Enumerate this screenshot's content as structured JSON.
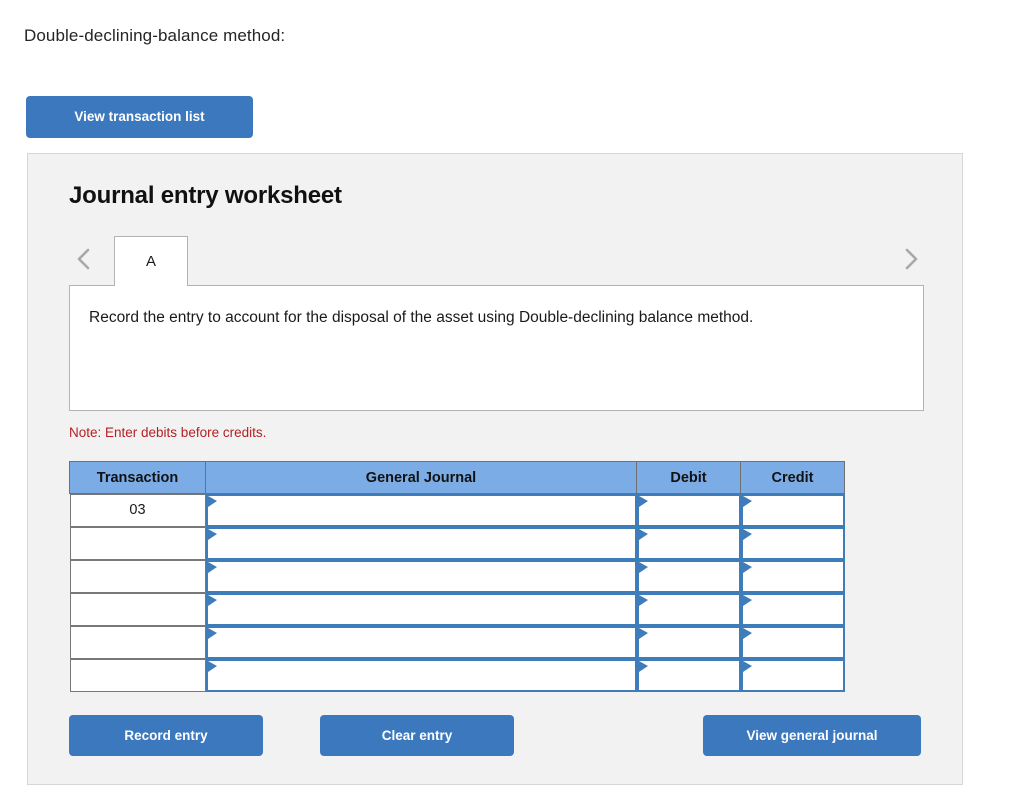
{
  "intro": {
    "text": "Double-declining-balance method:"
  },
  "toolbar": {
    "view_transaction_list_label": "View transaction list"
  },
  "worksheet": {
    "title": "Journal entry worksheet",
    "tabs": [
      {
        "label": "A",
        "active": true
      }
    ],
    "nav": {
      "prev_icon": "chevron-left-icon",
      "next_icon": "chevron-right-icon"
    },
    "description": "Record the entry to account for the disposal of the asset using Double-declining balance method.",
    "note": "Note: Enter debits before credits."
  },
  "table": {
    "headers": [
      "Transaction",
      "General Journal",
      "Debit",
      "Credit"
    ],
    "rows": [
      {
        "transaction": "03",
        "general_journal": "",
        "debit": "",
        "credit": ""
      },
      {
        "transaction": "",
        "general_journal": "",
        "debit": "",
        "credit": ""
      },
      {
        "transaction": "",
        "general_journal": "",
        "debit": "",
        "credit": ""
      },
      {
        "transaction": "",
        "general_journal": "",
        "debit": "",
        "credit": ""
      },
      {
        "transaction": "",
        "general_journal": "",
        "debit": "",
        "credit": ""
      },
      {
        "transaction": "",
        "general_journal": "",
        "debit": "",
        "credit": ""
      }
    ]
  },
  "actions": {
    "record_entry_label": "Record entry",
    "clear_entry_label": "Clear entry",
    "view_general_journal_label": "View general journal"
  },
  "colors": {
    "button_blue": "#3b78bd",
    "header_blue": "#7cace5",
    "cell_border_blue": "#3f7cba",
    "note_red": "#b52025",
    "panel_gray": "#f2f2f2"
  }
}
